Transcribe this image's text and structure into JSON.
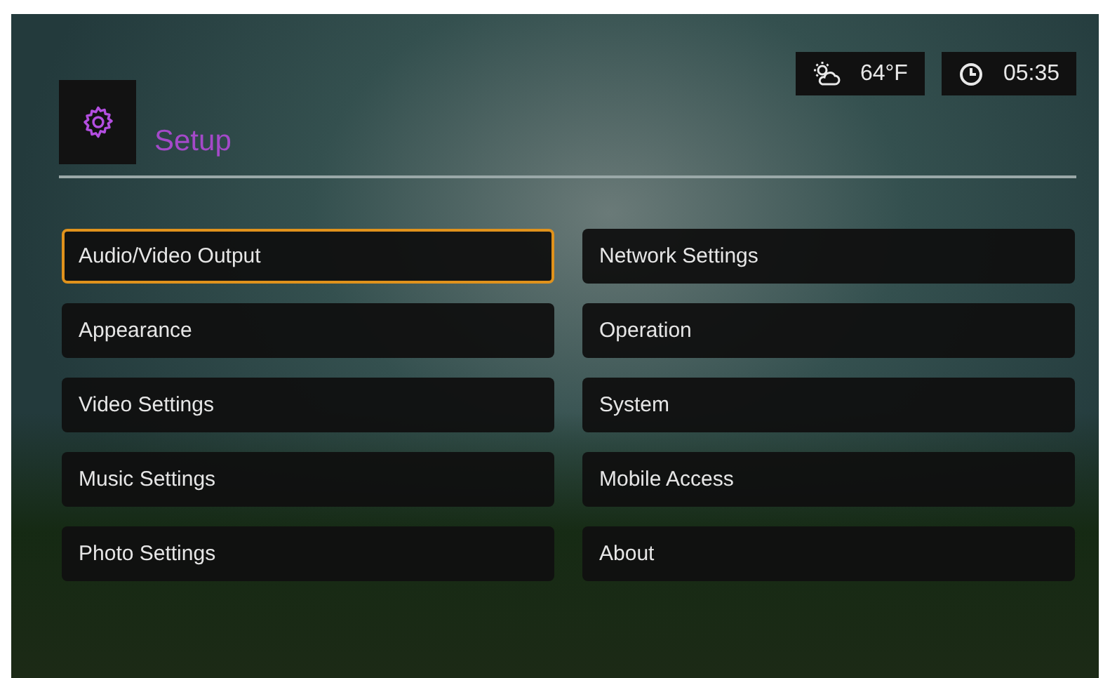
{
  "status": {
    "temperature": "64°F",
    "time": "05:35"
  },
  "header": {
    "title": "Setup"
  },
  "menu": {
    "columns": [
      [
        {
          "label": "Audio/Video Output",
          "selected": true
        },
        {
          "label": "Appearance",
          "selected": false
        },
        {
          "label": "Video Settings",
          "selected": false
        },
        {
          "label": "Music Settings",
          "selected": false
        },
        {
          "label": "Photo Settings",
          "selected": false
        }
      ],
      [
        {
          "label": "Network Settings",
          "selected": false
        },
        {
          "label": "Operation",
          "selected": false
        },
        {
          "label": "System",
          "selected": false
        },
        {
          "label": "Mobile Access",
          "selected": false
        },
        {
          "label": "About",
          "selected": false
        }
      ]
    ]
  }
}
